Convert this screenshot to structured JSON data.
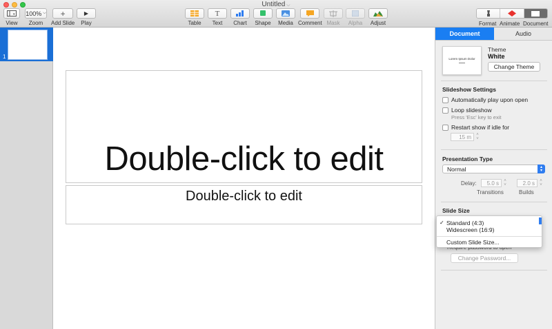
{
  "window": {
    "title": "Untitled"
  },
  "toolbar": {
    "view": {
      "label": "View"
    },
    "zoom": {
      "label": "Zoom",
      "value": "100%"
    },
    "add_slide": {
      "label": "Add Slide",
      "glyph": "+"
    },
    "play": {
      "label": "Play",
      "glyph": "▶"
    },
    "table": {
      "label": "Table"
    },
    "text": {
      "label": "Text",
      "glyph": "T"
    },
    "chart": {
      "label": "Chart"
    },
    "shape": {
      "label": "Shape"
    },
    "media": {
      "label": "Media"
    },
    "comment": {
      "label": "Comment"
    },
    "mask": {
      "label": "Mask"
    },
    "alpha": {
      "label": "Alpha"
    },
    "adjust": {
      "label": "Adjust"
    },
    "format": {
      "label": "Format"
    },
    "animate": {
      "label": "Animate"
    },
    "document": {
      "label": "Document"
    }
  },
  "navigator": {
    "slides": [
      {
        "number": "1"
      }
    ]
  },
  "slide": {
    "title_placeholder": "Double-click to edit",
    "subtitle_placeholder": "Double-click to edit"
  },
  "inspector": {
    "tabs": [
      {
        "label": "Document",
        "active": true
      },
      {
        "label": "Audio",
        "active": false
      }
    ],
    "theme": {
      "label": "Theme",
      "value": "White",
      "thumb_title": "Lorem Ipsum Dolor",
      "change_button": "Change Theme"
    },
    "slideshow": {
      "title": "Slideshow Settings",
      "auto_play": "Automatically play upon open",
      "loop": "Loop slideshow",
      "loop_hint": "Press 'Esc' key to exit",
      "restart": "Restart show if idle for",
      "idle_value": "15 m"
    },
    "presentation": {
      "title": "Presentation Type",
      "type_value": "Normal",
      "delay_label": "Delay:",
      "transitions_value": "5.0 s",
      "builds_value": "2.0 s",
      "transitions_label": "Transitions",
      "builds_label": "Builds"
    },
    "slide_size": {
      "title": "Slide Size",
      "menu": {
        "options": [
          {
            "label": "Standard (4:3)",
            "checked": true
          },
          {
            "label": "Widescreen (16:9)",
            "checked": false
          }
        ],
        "custom": "Custom Slide Size..."
      }
    },
    "password": {
      "require_label": "Require password to open",
      "change_button": "Change Password..."
    }
  },
  "colors": {
    "accent": "#1a7ef2",
    "selection": "#1a6fd6"
  }
}
